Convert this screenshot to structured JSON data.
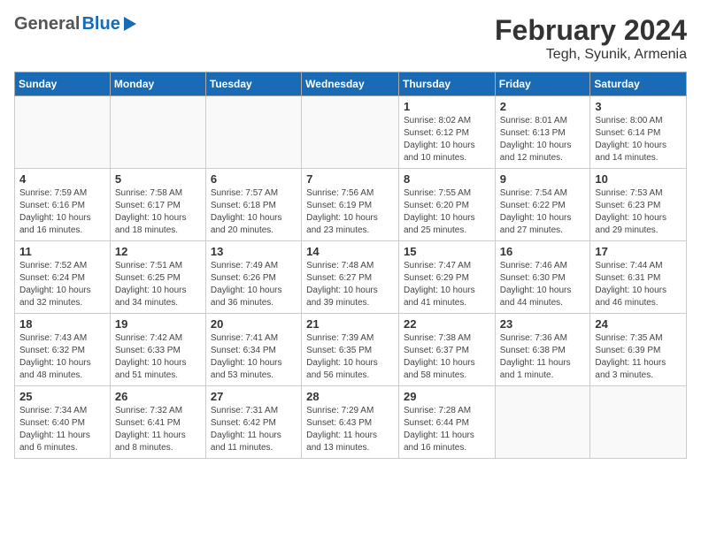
{
  "header": {
    "logo_general": "General",
    "logo_blue": "Blue",
    "title": "February 2024",
    "subtitle": "Tegh, Syunik, Armenia"
  },
  "days_of_week": [
    "Sunday",
    "Monday",
    "Tuesday",
    "Wednesday",
    "Thursday",
    "Friday",
    "Saturday"
  ],
  "weeks": [
    [
      {
        "day": "",
        "info": ""
      },
      {
        "day": "",
        "info": ""
      },
      {
        "day": "",
        "info": ""
      },
      {
        "day": "",
        "info": ""
      },
      {
        "day": "1",
        "info": "Sunrise: 8:02 AM\nSunset: 6:12 PM\nDaylight: 10 hours\nand 10 minutes."
      },
      {
        "day": "2",
        "info": "Sunrise: 8:01 AM\nSunset: 6:13 PM\nDaylight: 10 hours\nand 12 minutes."
      },
      {
        "day": "3",
        "info": "Sunrise: 8:00 AM\nSunset: 6:14 PM\nDaylight: 10 hours\nand 14 minutes."
      }
    ],
    [
      {
        "day": "4",
        "info": "Sunrise: 7:59 AM\nSunset: 6:16 PM\nDaylight: 10 hours\nand 16 minutes."
      },
      {
        "day": "5",
        "info": "Sunrise: 7:58 AM\nSunset: 6:17 PM\nDaylight: 10 hours\nand 18 minutes."
      },
      {
        "day": "6",
        "info": "Sunrise: 7:57 AM\nSunset: 6:18 PM\nDaylight: 10 hours\nand 20 minutes."
      },
      {
        "day": "7",
        "info": "Sunrise: 7:56 AM\nSunset: 6:19 PM\nDaylight: 10 hours\nand 23 minutes."
      },
      {
        "day": "8",
        "info": "Sunrise: 7:55 AM\nSunset: 6:20 PM\nDaylight: 10 hours\nand 25 minutes."
      },
      {
        "day": "9",
        "info": "Sunrise: 7:54 AM\nSunset: 6:22 PM\nDaylight: 10 hours\nand 27 minutes."
      },
      {
        "day": "10",
        "info": "Sunrise: 7:53 AM\nSunset: 6:23 PM\nDaylight: 10 hours\nand 29 minutes."
      }
    ],
    [
      {
        "day": "11",
        "info": "Sunrise: 7:52 AM\nSunset: 6:24 PM\nDaylight: 10 hours\nand 32 minutes."
      },
      {
        "day": "12",
        "info": "Sunrise: 7:51 AM\nSunset: 6:25 PM\nDaylight: 10 hours\nand 34 minutes."
      },
      {
        "day": "13",
        "info": "Sunrise: 7:49 AM\nSunset: 6:26 PM\nDaylight: 10 hours\nand 36 minutes."
      },
      {
        "day": "14",
        "info": "Sunrise: 7:48 AM\nSunset: 6:27 PM\nDaylight: 10 hours\nand 39 minutes."
      },
      {
        "day": "15",
        "info": "Sunrise: 7:47 AM\nSunset: 6:29 PM\nDaylight: 10 hours\nand 41 minutes."
      },
      {
        "day": "16",
        "info": "Sunrise: 7:46 AM\nSunset: 6:30 PM\nDaylight: 10 hours\nand 44 minutes."
      },
      {
        "day": "17",
        "info": "Sunrise: 7:44 AM\nSunset: 6:31 PM\nDaylight: 10 hours\nand 46 minutes."
      }
    ],
    [
      {
        "day": "18",
        "info": "Sunrise: 7:43 AM\nSunset: 6:32 PM\nDaylight: 10 hours\nand 48 minutes."
      },
      {
        "day": "19",
        "info": "Sunrise: 7:42 AM\nSunset: 6:33 PM\nDaylight: 10 hours\nand 51 minutes."
      },
      {
        "day": "20",
        "info": "Sunrise: 7:41 AM\nSunset: 6:34 PM\nDaylight: 10 hours\nand 53 minutes."
      },
      {
        "day": "21",
        "info": "Sunrise: 7:39 AM\nSunset: 6:35 PM\nDaylight: 10 hours\nand 56 minutes."
      },
      {
        "day": "22",
        "info": "Sunrise: 7:38 AM\nSunset: 6:37 PM\nDaylight: 10 hours\nand 58 minutes."
      },
      {
        "day": "23",
        "info": "Sunrise: 7:36 AM\nSunset: 6:38 PM\nDaylight: 11 hours\nand 1 minute."
      },
      {
        "day": "24",
        "info": "Sunrise: 7:35 AM\nSunset: 6:39 PM\nDaylight: 11 hours\nand 3 minutes."
      }
    ],
    [
      {
        "day": "25",
        "info": "Sunrise: 7:34 AM\nSunset: 6:40 PM\nDaylight: 11 hours\nand 6 minutes."
      },
      {
        "day": "26",
        "info": "Sunrise: 7:32 AM\nSunset: 6:41 PM\nDaylight: 11 hours\nand 8 minutes."
      },
      {
        "day": "27",
        "info": "Sunrise: 7:31 AM\nSunset: 6:42 PM\nDaylight: 11 hours\nand 11 minutes."
      },
      {
        "day": "28",
        "info": "Sunrise: 7:29 AM\nSunset: 6:43 PM\nDaylight: 11 hours\nand 13 minutes."
      },
      {
        "day": "29",
        "info": "Sunrise: 7:28 AM\nSunset: 6:44 PM\nDaylight: 11 hours\nand 16 minutes."
      },
      {
        "day": "",
        "info": ""
      },
      {
        "day": "",
        "info": ""
      }
    ]
  ]
}
